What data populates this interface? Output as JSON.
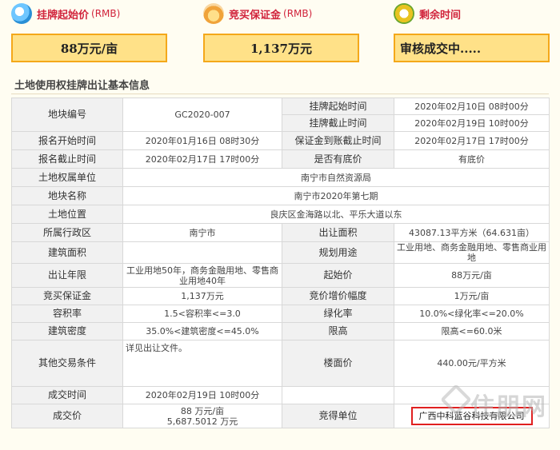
{
  "summary": {
    "start_price_label": "挂牌起始价",
    "start_price_unit": "(RMB)",
    "start_price_value": "88万元/亩",
    "deposit_label": "竞买保证金",
    "deposit_unit": "(RMB)",
    "deposit_value": "1,137万元",
    "time_label": "剩余时间",
    "time_value": "审核成交中....."
  },
  "section_title": "土地使用权挂牌出让基本信息",
  "table": {
    "plot_no_label": "地块编号",
    "plot_no": "GC2020-007",
    "listing_start_label": "挂牌起始时间",
    "listing_start": "2020年02月10日 08时00分",
    "listing_end_label": "挂牌截止时间",
    "listing_end": "2020年02月19日 10时00分",
    "reg_start_label": "报名开始时间",
    "reg_start": "2020年01月16日 08时30分",
    "deposit_deadline_label": "保证金到账截止时间",
    "deposit_deadline": "2020年02月17日 17时00分",
    "reg_end_label": "报名截止时间",
    "reg_end": "2020年02月17日 17时00分",
    "reserve_label": "是否有底价",
    "reserve": "有底价",
    "owner_label": "土地权属单位",
    "owner": "南宁市自然资源局",
    "plot_name_label": "地块名称",
    "plot_name": "南宁市2020年第七期",
    "location_label": "土地位置",
    "location": "良庆区金海路以北、平乐大道以东",
    "district_label": "所属行政区",
    "district": "南宁市",
    "area_label": "出让面积",
    "area": "43087.13平方米（64.631亩）",
    "build_area_label": "建筑面积",
    "build_area": "",
    "planned_use_label": "规划用途",
    "planned_use": "工业用地、商务金融用地、零售商业用地",
    "term_label": "出让年限",
    "term": "工业用地50年，商务金融用地、零售商业用地40年",
    "start_price_label": "起始价",
    "start_price": "88万元/亩",
    "bid_deposit_label": "竞买保证金",
    "bid_deposit": "1,137万元",
    "increment_label": "竞价增价幅度",
    "increment": "1万元/亩",
    "far_label": "容积率",
    "far": "1.5<容积率<=3.0",
    "green_label": "绿化率",
    "green": "10.0%<绿化率<=20.0%",
    "density_label": "建筑密度",
    "density": "35.0%<建筑密度<=45.0%",
    "height_label": "限高",
    "height": "限高<=60.0米",
    "other_label": "其他交易条件",
    "other": "详见出让文件。",
    "floor_price_label": "楼面价",
    "floor_price": "440.00元/平方米",
    "deal_time_label": "成交时间",
    "deal_time": "2020年02月19日 10时00分",
    "deal_price_label": "成交价",
    "deal_price_1": "88 万元/亩",
    "deal_price_2": "5,687.5012 万元",
    "winner_label": "竞得单位",
    "winner": "广西中科蓝谷科技有限公司"
  },
  "watermark": "住朋网"
}
